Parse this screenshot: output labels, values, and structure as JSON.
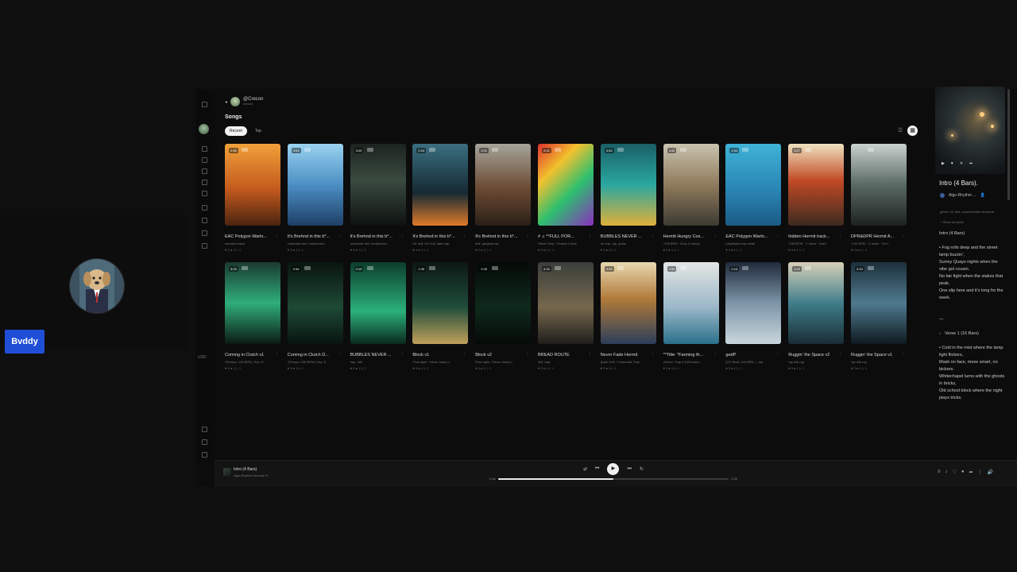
{
  "participant": {
    "name": "Bvddy"
  },
  "profile": {
    "handle": "@Crecon",
    "sub": "crecon"
  },
  "section_title": "Songs",
  "tabs": [
    {
      "label": "Recent"
    },
    {
      "label": "Top"
    }
  ],
  "songs": [
    {
      "title": "EAC Polygon Warlo...",
      "desc": "sounds nostal",
      "duration": "2:55",
      "stats": "♥ 3 ● 1 ▷ 1"
    },
    {
      "title": "It's Brehnd in this b*...",
      "desc": "cinematic drill, hardsocket,",
      "duration": "3:03",
      "stats": "♥ 3 ● 1 ▷ 1"
    },
    {
      "title": "It's Brehnd in this b*...",
      "desc": "cinematic drill, hardsocket,",
      "duration": "3:29",
      "stats": "♥ 3 ● 1 ▷ 1"
    },
    {
      "title": "It's Brehnd in this b*...",
      "desc": "UK drill, 8/1 doll, dark trap",
      "duration": "2:24",
      "stats": "♥ 3 ● 1 ▷ 1"
    },
    {
      "title": "It's Brehnd in this b*...",
      "desc": "drill, gangsta rap",
      "duration": "2:01",
      "stats": "♥ 3 ● 1 ▷ 1"
    },
    {
      "title": "# ♫ **FULL POR...",
      "desc": "Street Trap + Gospel Come",
      "duration": "2:21",
      "stats": "♥ 3 ● 1 ▷ 1"
    },
    {
      "title": "BUBBLES NEVER ...",
      "desc": "uk trap, rap, grime",
      "duration": "3:04",
      "stats": "♥ 3 ● 1 ▷ 1"
    },
    {
      "title": "Hermit Hungry Cos...",
      "desc": "*138 BPM · Drop & tuning",
      "duration": "4:42",
      "stats": "♥ 3 ● 1 ▷ 1"
    },
    {
      "title": "EAC Polygon Warlo...",
      "desc": "prisyblack trap metal",
      "duration": "4:04",
      "stats": "♥ 3 ● 1 ▷ 1"
    },
    {
      "title": "hidden Hermit track...",
      "desc": "*138 BPM · C minor · Dark",
      "duration": "3:27",
      "stats": "♥ 3 ● 1 ▷ 1"
    },
    {
      "title": "DPR&DPR Hermit A...",
      "desc": "*140 BPM · C minor · 3/4 t",
      "duration": "",
      "stats": "♥ 3 ● 1 ▷ 1"
    },
    {
      "title": "Coming in Clutch v1",
      "desc": "*[Tempo: 126 BPM | Key: D",
      "duration": "3:03",
      "stats": "♥ 3 ● 1 ▷ 1"
    },
    {
      "title": "Coming in Clutch D...",
      "desc": "*[Tempo: 126 BPM | Key: D",
      "duration": "2:54",
      "stats": "♥ 3 ● 1 ▷ 1"
    },
    {
      "title": "BUBBLES NEVER ...",
      "desc": "trap, drill",
      "duration": "2:19",
      "stats": "♥ 3 ● 1 ▷ 1"
    },
    {
      "title": "Block v1",
      "desc": "Flow style: **slow, heavy c",
      "duration": "2:30",
      "stats": "♥ 3 ● 1 ▷ 1"
    },
    {
      "title": "Block v2",
      "desc": "Flow style: **slow, heavy c",
      "duration": "2:35",
      "stats": "♥ 3 ● 1 ▷ 1"
    },
    {
      "title": "BREAD ROUTE",
      "desc": "drill, trap",
      "duration": "3:15",
      "stats": "♥ 3 ● 1 ▷ 1"
    },
    {
      "title": "Never Fade Hermit",
      "desc": "[Dark Drill + Cinematic Trap",
      "duration": "3:29",
      "stats": "♥ 3 ● 1 ▷ 1"
    },
    {
      "title": "**Title: *Farming th...",
      "desc": "[Genre: Trap & Drill fusion",
      "duration": "2:54",
      "stats": "♥ 3 ● 1 ▷ 1"
    },
    {
      "title": "gedP",
      "desc": "[OG Beat: 140 BPM — dar",
      "duration": "2:14",
      "stats": "♥ 3 ● 1 ▷ 1"
    },
    {
      "title": "Ruggin' the Space v2",
      "desc": "rap drill rap",
      "duration": "2:43",
      "stats": "♥ 3 ● 1 ▷ 1"
    },
    {
      "title": "Ruggin' the Space v1",
      "desc": "rap drill rap",
      "duration": "2:19",
      "stats": "♥ 3 ● 1 ▷ 1"
    }
  ],
  "now_playing": {
    "title": "Intro (4 Bars).",
    "artist": "Algo-Rhythm ...",
    "tags": "grime, UK drill, experimental electronic",
    "show_more": "+ Show full lyrics",
    "lyrics": "Intro (4 Bars)\n\n• Fog rolls deep and the street lamp buzzin',\nSurrey Quays nights when the vibe got cousin.\nNo fair fight when the stakes that peak,\nOne slip here and it's long for the week.\n\n\n—\n\n♩ Verse 1 (16 Bars)\n\n• Cold in the mist where the lamp light flickers,\nMask on face, move smart, no bickers.\nWhitechapel turns with the ghosts in bricks,\nOld school block where the night plays tricks."
  },
  "player": {
    "title": "Intro (4 Bars)",
    "artist": "Algo-Rhythm Records ®",
    "elapsed": "0:46",
    "total": "2:28",
    "progress": 0.5
  },
  "rail_text": "USD"
}
